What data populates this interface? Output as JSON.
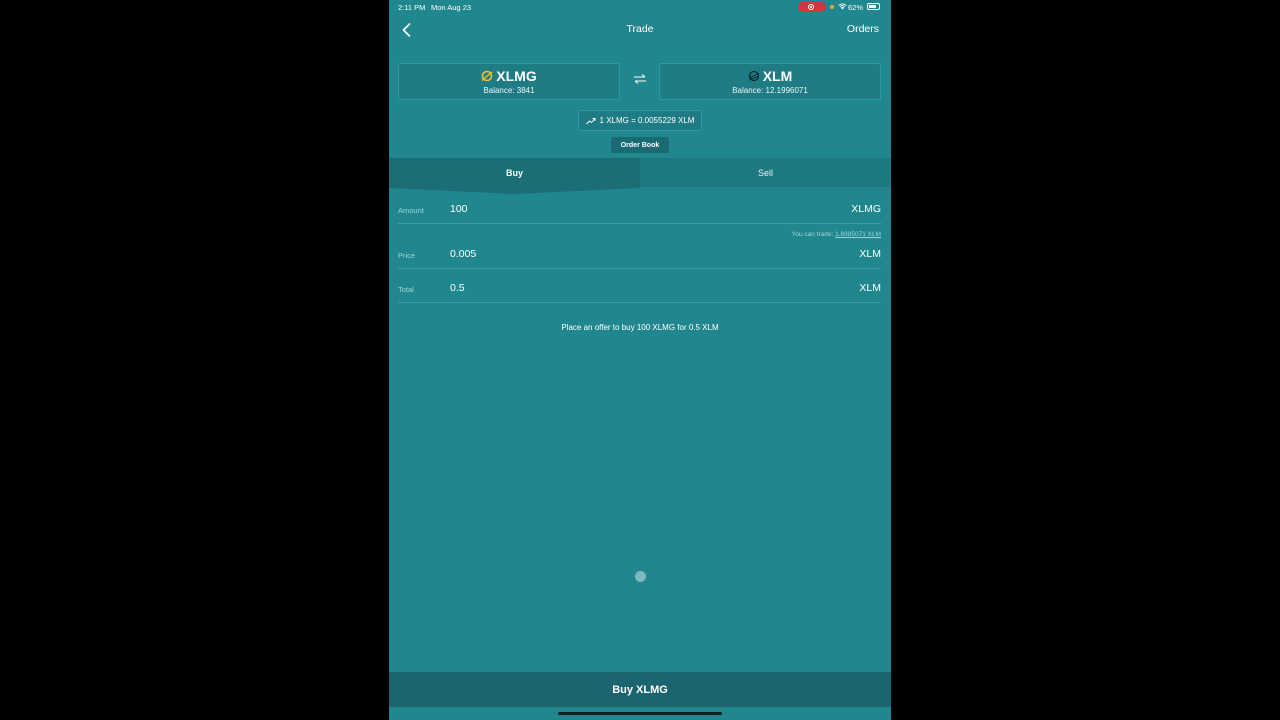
{
  "status_bar": {
    "time": "2:11 PM",
    "date": "Mon Aug 23",
    "battery": "62%"
  },
  "nav": {
    "title": "Trade",
    "orders_label": "Orders"
  },
  "assets": {
    "left": {
      "code": "XLMG",
      "balance": "Balance: 3841"
    },
    "right": {
      "code": "XLM",
      "balance": "Balance: 12.1996071"
    }
  },
  "rate": "1 XLMG = 0.0055229 XLM",
  "order_book_label": "Order Book",
  "tabs": {
    "buy": "Buy",
    "sell": "Sell",
    "active": "buy"
  },
  "form": {
    "amount": {
      "label": "Amount",
      "value": "100",
      "unit": "XLMG"
    },
    "can_trade_prefix": "You can trade:",
    "can_trade_value": "1.6985071 XLM",
    "price": {
      "label": "Price",
      "value": "0.005",
      "unit": "XLM"
    },
    "total": {
      "label": "Total",
      "value": "0.5",
      "unit": "XLM"
    }
  },
  "offer_summary": "Place an offer to buy 100 XLMG for 0.5 XLM",
  "buy_button_label": "Buy XLMG",
  "colors": {
    "background": "#21878f",
    "tab_active": "#1b6d76",
    "record_pill": "#d6333c",
    "xlmg_logo": "#f2c230"
  }
}
